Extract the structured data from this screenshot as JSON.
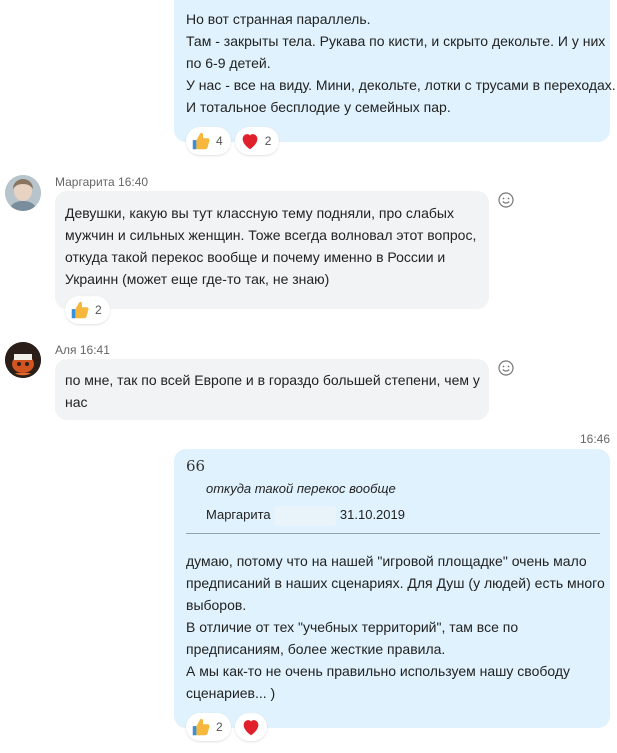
{
  "messages": {
    "m1": {
      "lines": [
        "Но вот странная параллель.",
        "Там - закрыты тела. Рукава по кисти, и скрыто декольте. И у них",
        "по 6-9 детей.",
        "У нас - все на виду. Мини, декольте, лотки с трусами в переходах.",
        "И тотальное бесплодие у семейных пар."
      ],
      "reactions": [
        {
          "icon": "thumbs-up-icon",
          "count": "4"
        },
        {
          "icon": "heart-icon",
          "count": "2"
        }
      ]
    },
    "m2": {
      "sender": "Маргарита",
      "time": "16:40",
      "lines": [
        "Девушки, какую вы тут классную тему подняли, про слабых",
        "мужчин и сильных женщин. Тоже всегда волновал этот вопрос,",
        "откуда такой перекос вообще и почему именно в России и",
        "Украинн (может еще где-то так, не знаю)"
      ],
      "reactions": [
        {
          "icon": "thumbs-up-icon",
          "count": "2"
        }
      ]
    },
    "m3": {
      "sender": "Аля",
      "time": "16:41",
      "lines": [
        "по мне, так по всей Европе и в гораздо большей  степени, чем у",
        "нас"
      ]
    },
    "m4": {
      "time": "16:46",
      "quote_mark": "66",
      "quote_text": "откуда такой перекос вообще",
      "quote_author": "Маргарита",
      "quote_date": "31.10.2019",
      "lines": [
        "думаю, потому что на нашей \"игровой площадке\" очень мало",
        "предписаний в наших сценариях. Для Душ (у людей) есть много",
        "выборов.",
        "В отличие от тех \"учебных территорий\", там все по",
        "предписаниям, более жесткие правила.",
        "А мы как-то не очень правильно используем нашу свободу",
        "сценариев... )"
      ],
      "reactions": [
        {
          "icon": "thumbs-up-icon",
          "count": "2"
        },
        {
          "icon": "heart-icon",
          "count": ""
        }
      ]
    }
  },
  "colors": {
    "outgoing_bubble": "#dff2fd",
    "incoming_bubble": "#f1f3f5",
    "heart": "#e0212b",
    "thumb": "#f6b73c"
  }
}
